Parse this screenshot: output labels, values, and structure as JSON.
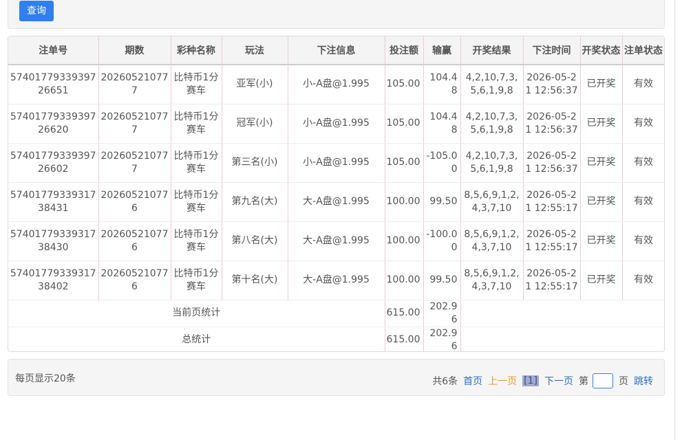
{
  "query": {
    "button_label": "查询"
  },
  "table": {
    "headers": [
      "注单号",
      "期数",
      "彩种名称",
      "玩法",
      "下注信息",
      "投注额",
      "输赢",
      "开奖结果",
      "下注时间",
      "开奖状态",
      "注单状态"
    ],
    "rows": [
      [
        "5740177933939726651",
        "202605210777",
        "比特币1分赛车",
        "亚军(小)",
        "小-A盘@1.995",
        "105.00",
        "104.48",
        "4,2,10,7,3,5,6,1,9,8",
        "2026-05-21 12:56:37",
        "已开奖",
        "有效"
      ],
      [
        "5740177933939726620",
        "202605210777",
        "比特币1分赛车",
        "冠军(小)",
        "小-A盘@1.995",
        "105.00",
        "104.48",
        "4,2,10,7,3,5,6,1,9,8",
        "2026-05-21 12:56:37",
        "已开奖",
        "有效"
      ],
      [
        "5740177933939726602",
        "202605210777",
        "比特币1分赛车",
        "第三名(小)",
        "小-A盘@1.995",
        "105.00",
        "-105.00",
        "4,2,10,7,3,5,6,1,9,8",
        "2026-05-21 12:56:37",
        "已开奖",
        "有效"
      ],
      [
        "5740177933931738431",
        "202605210776",
        "比特币1分赛车",
        "第九名(大)",
        "大-A盘@1.995",
        "100.00",
        "99.50",
        "8,5,6,9,1,2,4,3,7,10",
        "2026-05-21 12:55:17",
        "已开奖",
        "有效"
      ],
      [
        "5740177933931738430",
        "202605210776",
        "比特币1分赛车",
        "第八名(大)",
        "大-A盘@1.995",
        "100.00",
        "-100.00",
        "8,5,6,9,1,2,4,3,7,10",
        "2026-05-21 12:55:17",
        "已开奖",
        "有效"
      ],
      [
        "5740177933931738402",
        "202605210776",
        "比特币1分赛车",
        "第十名(大)",
        "大-A盘@1.995",
        "100.00",
        "99.50",
        "8,5,6,9,1,2,4,3,7,10",
        "2026-05-21 12:55:17",
        "已开奖",
        "有效"
      ]
    ],
    "page_summary": {
      "label": "当前页统计",
      "bet": "615.00",
      "win": "202.96"
    },
    "total_summary": {
      "label": "总统计",
      "bet": "615.00",
      "win": "202.96"
    }
  },
  "pagination": {
    "per_page": "每页显示20条",
    "total": "共6条",
    "first": "首页",
    "prev": "上一页",
    "current": "[1]",
    "next": "下一页",
    "goto_prefix": "第",
    "goto_suffix": "页",
    "jump": "跳转",
    "goto_value": ""
  },
  "colors": {
    "primary": "#2f7ff0",
    "link": "#2f6fc4",
    "prev": "#e69a2e",
    "current_bg": "#a5aac8"
  }
}
